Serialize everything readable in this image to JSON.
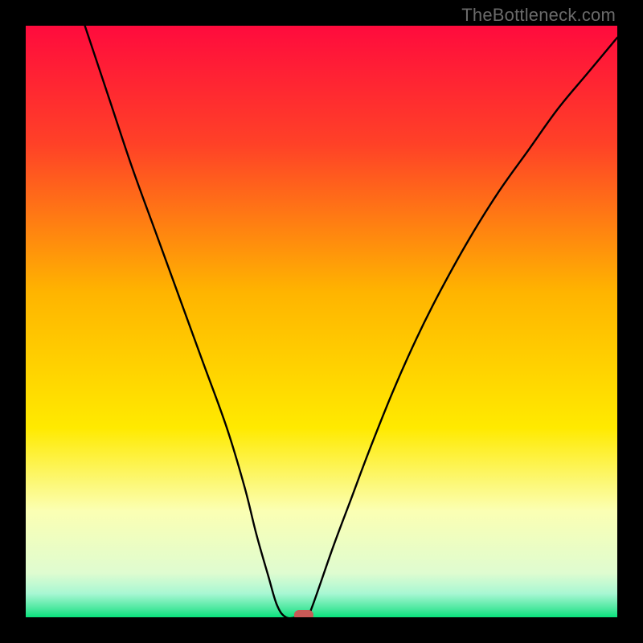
{
  "watermark": {
    "text": "TheBottleneck.com"
  },
  "chart_data": {
    "type": "line",
    "title": "",
    "xlabel": "",
    "ylabel": "",
    "x_range": [
      0,
      100
    ],
    "y_range": [
      0,
      100
    ],
    "grid": false,
    "legend": false,
    "background_gradient": {
      "orientation": "vertical",
      "stops": [
        {
          "pct": 0,
          "color": "#ff0b3d"
        },
        {
          "pct": 20,
          "color": "#ff4127"
        },
        {
          "pct": 45,
          "color": "#ffb400"
        },
        {
          "pct": 68,
          "color": "#ffea00"
        },
        {
          "pct": 82,
          "color": "#fbffb3"
        },
        {
          "pct": 92.5,
          "color": "#dffcd0"
        },
        {
          "pct": 96,
          "color": "#a8f7d3"
        },
        {
          "pct": 98.5,
          "color": "#4de8a0"
        },
        {
          "pct": 100,
          "color": "#09e37c"
        }
      ]
    },
    "series": [
      {
        "name": "bottleneck-curve",
        "color": "#000000",
        "x": [
          10,
          14,
          18,
          22,
          26,
          30,
          34,
          37,
          39,
          41,
          42.5,
          44,
          46,
          47.5,
          48.5,
          52,
          55,
          58,
          62,
          66,
          70,
          75,
          80,
          85,
          90,
          95,
          100
        ],
        "y": [
          100,
          88,
          76,
          65,
          54,
          43,
          32,
          22,
          14,
          7,
          2,
          0,
          0,
          0,
          2,
          12,
          20,
          28,
          38,
          47,
          55,
          64,
          72,
          79,
          86,
          92,
          98
        ]
      }
    ],
    "marker": {
      "x": 47,
      "y": 0,
      "shape": "rounded-rect",
      "color": "#c95a57"
    }
  }
}
